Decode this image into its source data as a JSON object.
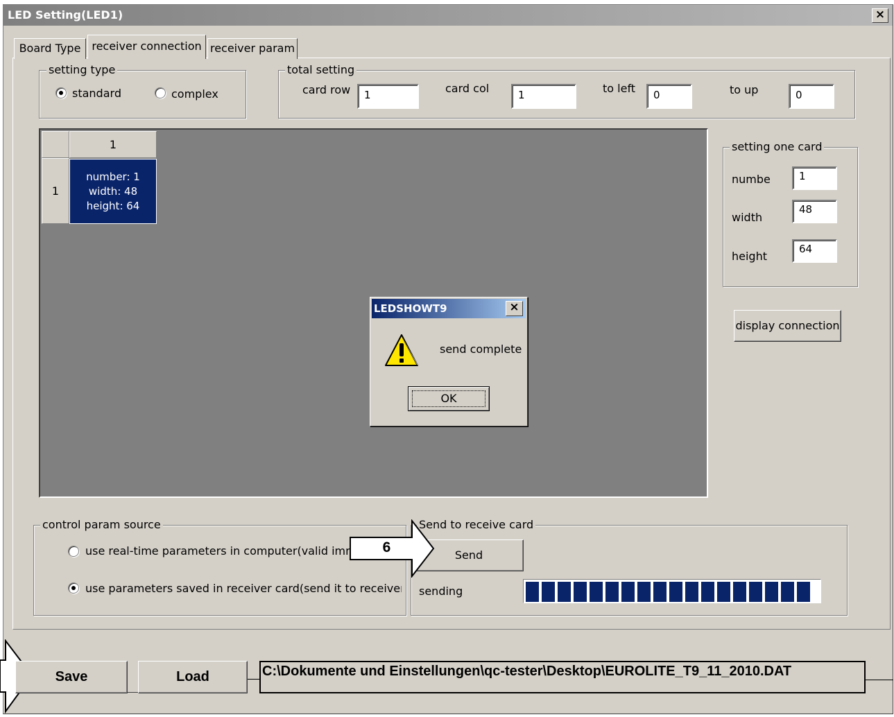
{
  "window": {
    "title": "LED Setting(LED1)",
    "close_label": "×"
  },
  "tabs": [
    {
      "label": "Board Type"
    },
    {
      "label": "receiver connection"
    },
    {
      "label": "receiver param"
    }
  ],
  "setting_type": {
    "legend": "setting type",
    "options": [
      {
        "label": "standard",
        "selected": true
      },
      {
        "label": "complex",
        "selected": false
      }
    ]
  },
  "total_setting": {
    "legend": "total setting",
    "fields": [
      {
        "label": "card row",
        "value": "1"
      },
      {
        "label": "card col",
        "value": "1"
      },
      {
        "label": "to left",
        "value": "0"
      },
      {
        "label": "to up",
        "value": "0"
      }
    ]
  },
  "grid": {
    "col_header": "1",
    "row_header": "1",
    "card": {
      "number_line": "number:  1",
      "width_line": "width:  48",
      "height_line": "height:  64"
    }
  },
  "setting_one_card": {
    "legend": "setting one card",
    "fields": [
      {
        "label": "numbe",
        "value": "1"
      },
      {
        "label": "width",
        "value": "48"
      },
      {
        "label": "height",
        "value": "64"
      }
    ]
  },
  "display_connection_label": "display connection",
  "dialog": {
    "title": "LEDSHOWT9",
    "close_label": "×",
    "message": "send complete",
    "ok_label": "OK",
    "icon": "warning-icon"
  },
  "control_param_source": {
    "legend": "control param source",
    "options": [
      {
        "label": "use real-time parameters in computer(valid immedi",
        "selected": false
      },
      {
        "label": "use parameters saved in receiver card(send it to receiver ca",
        "selected": true
      }
    ]
  },
  "send_group": {
    "legend": "Send to receive card",
    "send_label": "Send",
    "status_label": "sending",
    "progress_percent": 100
  },
  "callout_step": "6",
  "bottom": {
    "save_label": "Save",
    "load_label": "Load",
    "path": "C:\\Dokumente und Einstellungen\\qc-tester\\Desktop\\EUROLITE_T9_11_2010.DAT"
  },
  "colors": {
    "face": "#d4d0c8",
    "selection": "#0a246a",
    "grid_bg": "#808080"
  }
}
